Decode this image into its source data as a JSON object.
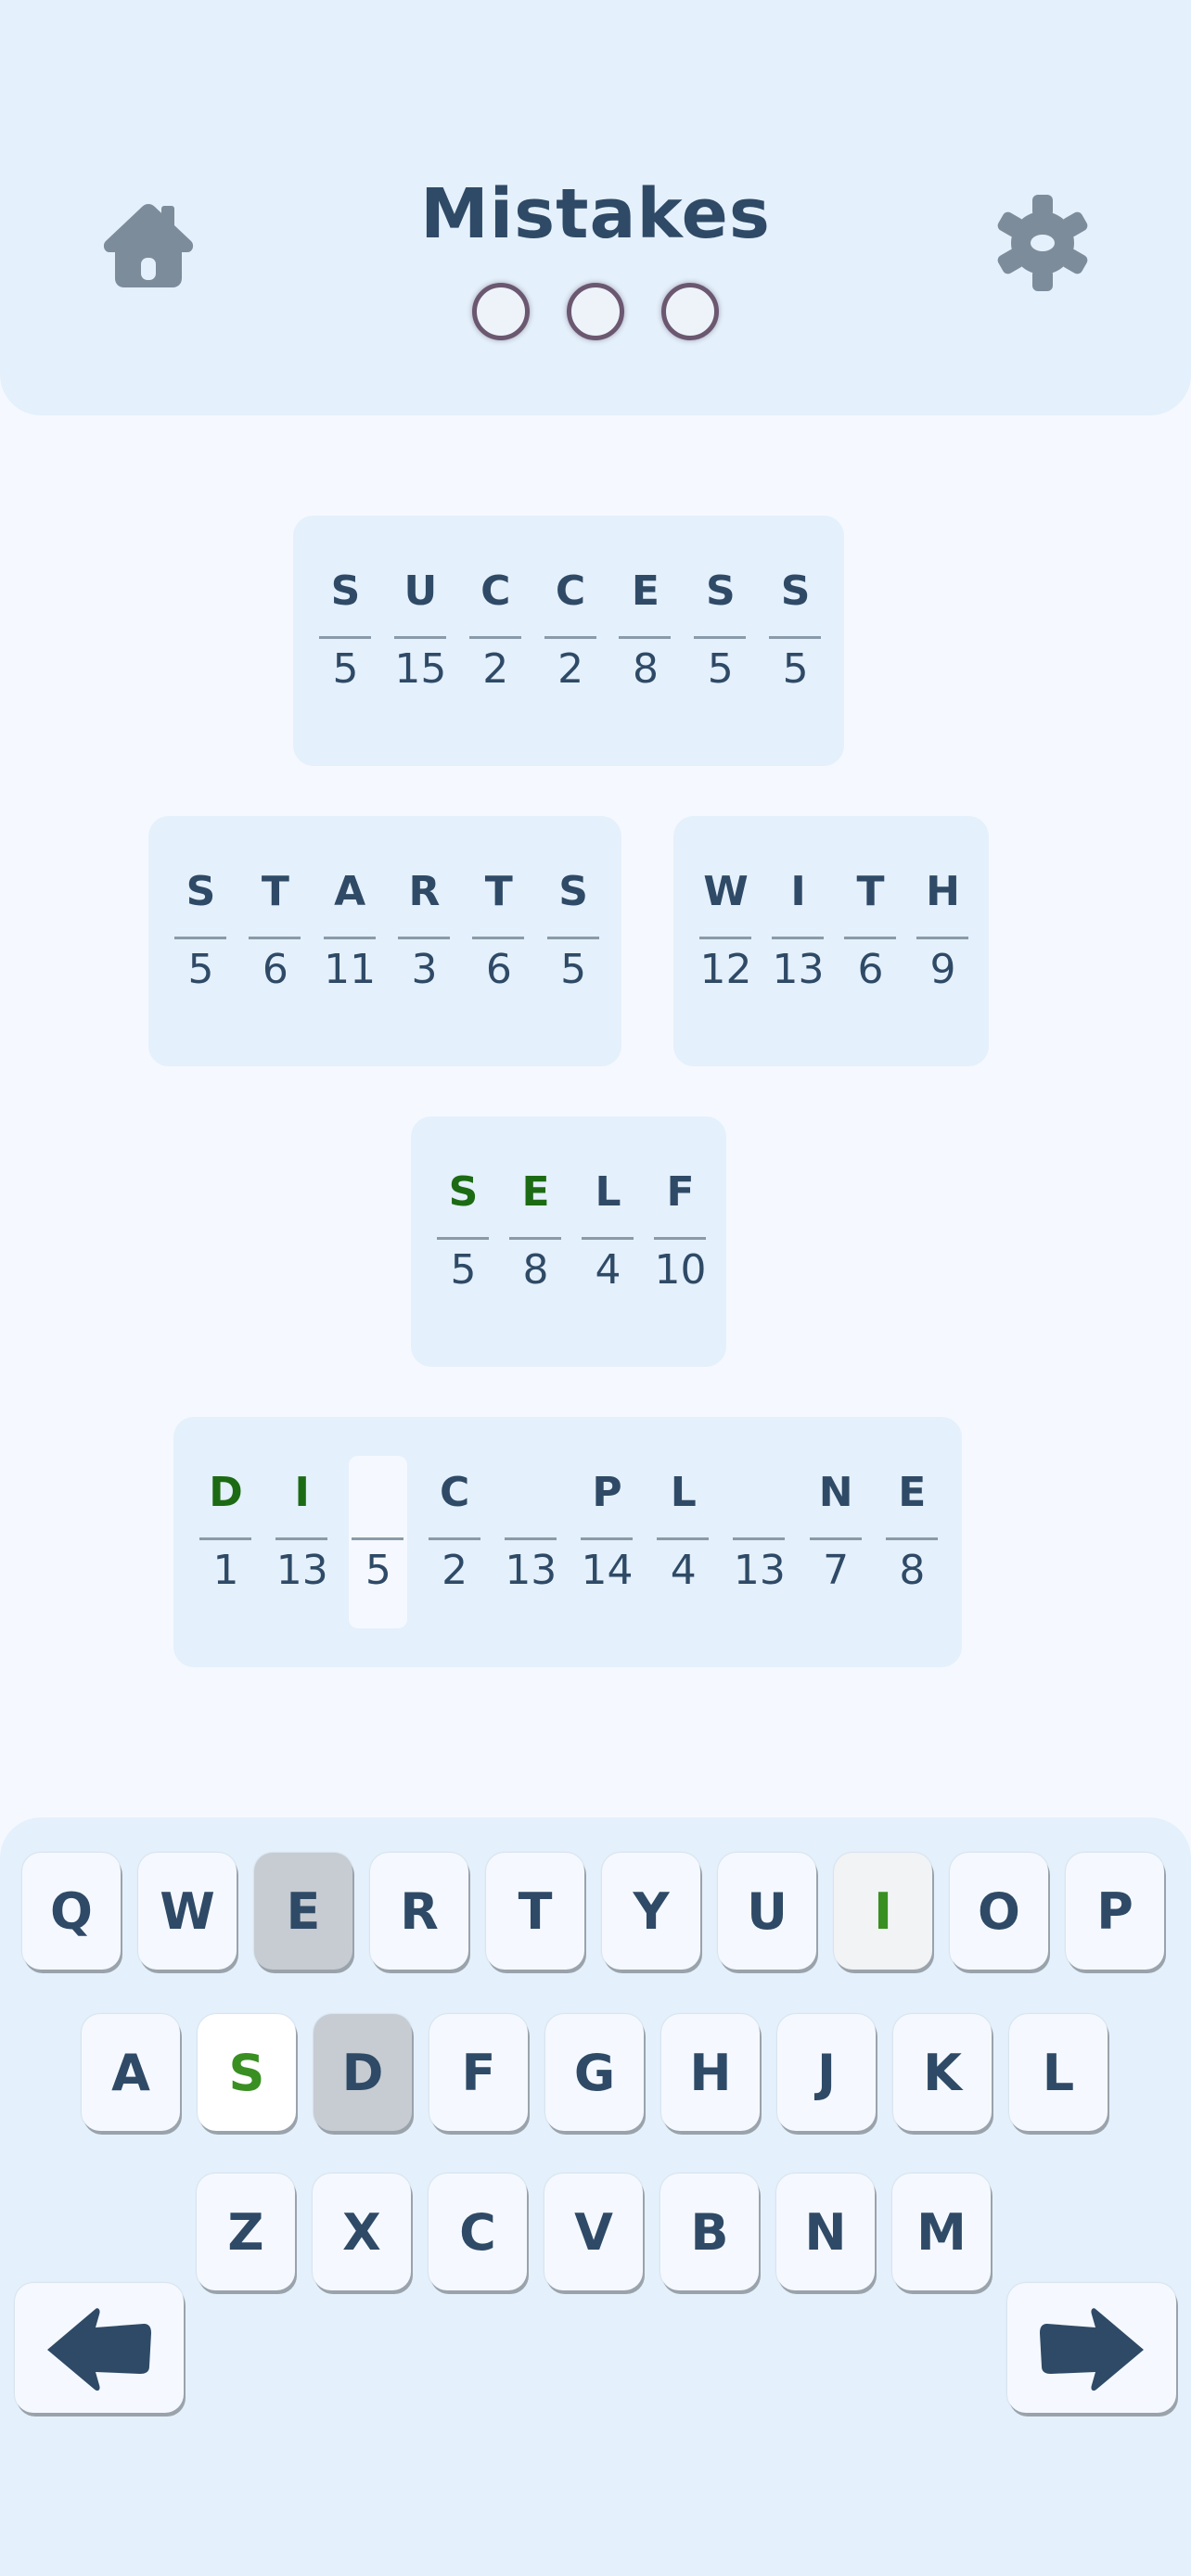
{
  "header": {
    "title": "Mistakes",
    "mistakes_total": 3,
    "mistakes_used": 0,
    "home_icon": "home-icon",
    "settings_icon": "gear-icon"
  },
  "colors": {
    "background": "#f5f9ff",
    "panel": "#e4f0fb",
    "text": "#2f4a66",
    "correct": "#1c6b14",
    "key_found": "#3a8f22",
    "key_used": "#c7ccd2"
  },
  "puzzle": {
    "words": [
      {
        "letters": [
          {
            "l": "S",
            "n": "5"
          },
          {
            "l": "U",
            "n": "15"
          },
          {
            "l": "C",
            "n": "2"
          },
          {
            "l": "C",
            "n": "2"
          },
          {
            "l": "E",
            "n": "8"
          },
          {
            "l": "S",
            "n": "5"
          },
          {
            "l": "S",
            "n": "5"
          }
        ]
      },
      {
        "letters": [
          {
            "l": "S",
            "n": "5"
          },
          {
            "l": "T",
            "n": "6"
          },
          {
            "l": "A",
            "n": "11"
          },
          {
            "l": "R",
            "n": "3"
          },
          {
            "l": "T",
            "n": "6"
          },
          {
            "l": "S",
            "n": "5"
          }
        ]
      },
      {
        "letters": [
          {
            "l": "W",
            "n": "12"
          },
          {
            "l": "I",
            "n": "13"
          },
          {
            "l": "T",
            "n": "6"
          },
          {
            "l": "H",
            "n": "9"
          }
        ]
      },
      {
        "letters": [
          {
            "l": "S",
            "n": "5",
            "state": "correct"
          },
          {
            "l": "E",
            "n": "8",
            "state": "correct"
          },
          {
            "l": "L",
            "n": "4"
          },
          {
            "l": "F",
            "n": "10"
          }
        ]
      },
      {
        "letters": [
          {
            "l": "D",
            "n": "1",
            "state": "correct"
          },
          {
            "l": "I",
            "n": "13",
            "state": "correct"
          },
          {
            "l": "",
            "n": "5",
            "state": "selected"
          },
          {
            "l": "C",
            "n": "2"
          },
          {
            "l": "",
            "n": "13"
          },
          {
            "l": "P",
            "n": "14"
          },
          {
            "l": "L",
            "n": "4"
          },
          {
            "l": "",
            "n": "13"
          },
          {
            "l": "N",
            "n": "7"
          },
          {
            "l": "E",
            "n": "8"
          }
        ]
      }
    ]
  },
  "keyboard": {
    "rows": [
      [
        "Q",
        "W",
        "E",
        "R",
        "T",
        "Y",
        "U",
        "I",
        "O",
        "P"
      ],
      [
        "A",
        "S",
        "D",
        "F",
        "G",
        "H",
        "J",
        "K",
        "L"
      ],
      [
        "Z",
        "X",
        "C",
        "V",
        "B",
        "N",
        "M"
      ]
    ],
    "key_states": {
      "E": "used",
      "D": "used",
      "S": "found",
      "I": "found-soft"
    },
    "prev_icon": "arrow-left-icon",
    "next_icon": "arrow-right-icon"
  }
}
